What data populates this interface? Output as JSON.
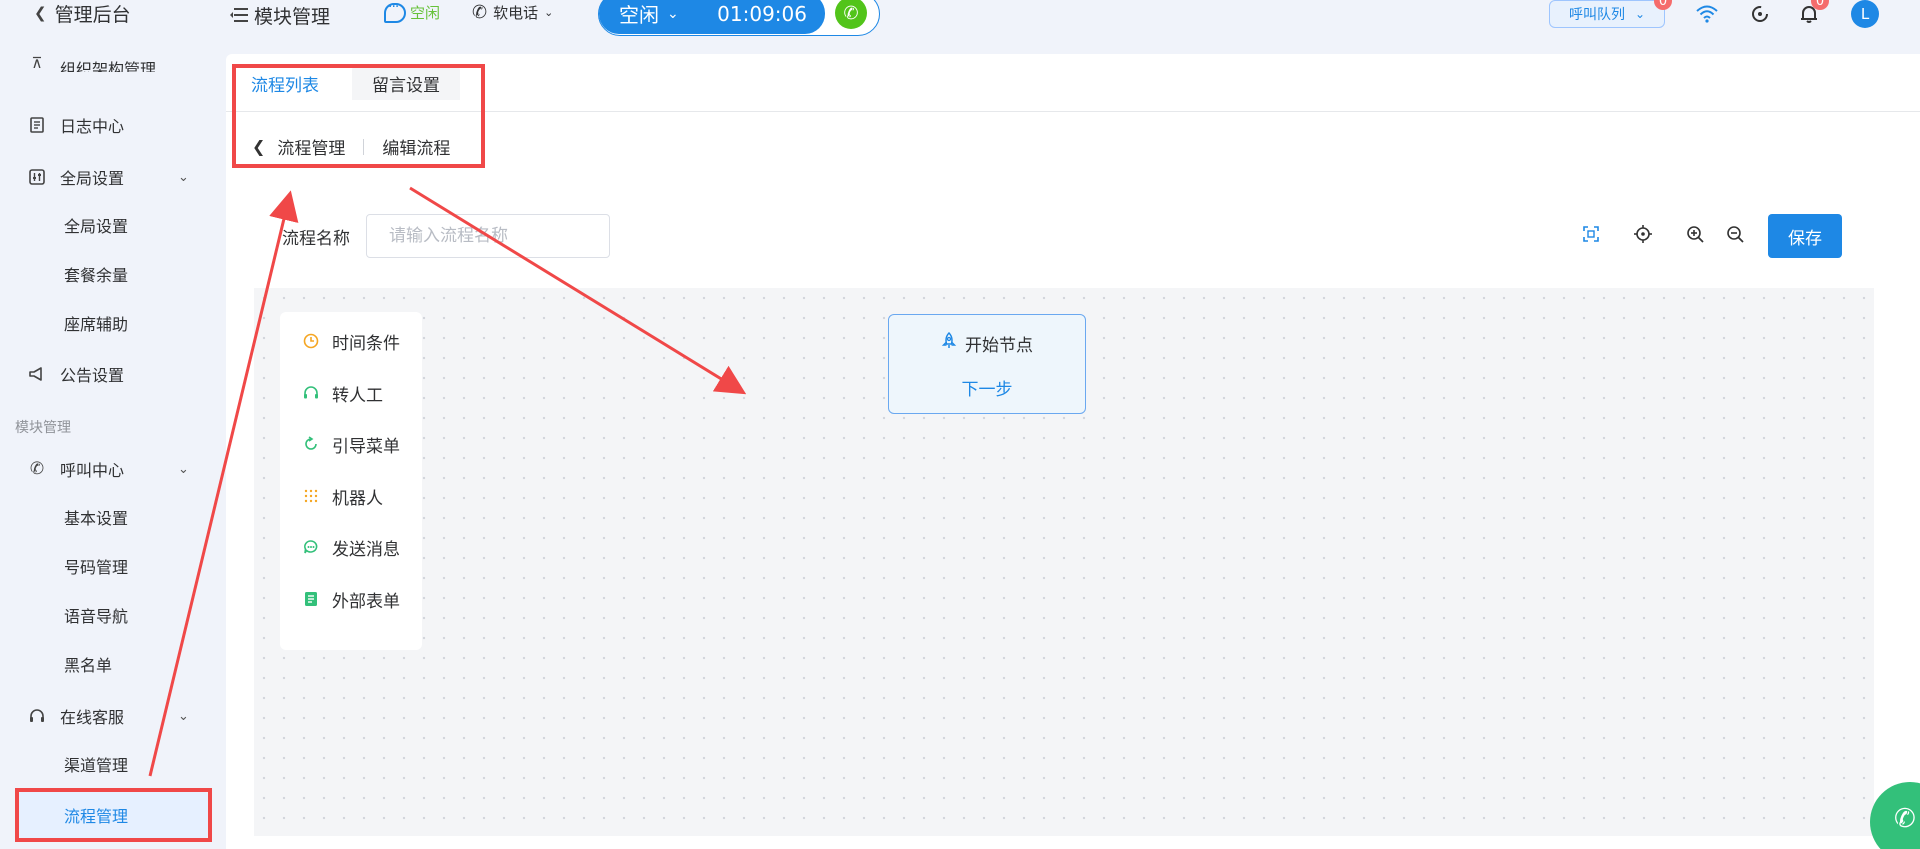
{
  "topbar": {
    "back_label": "管理后台",
    "module_label": "模块管理",
    "status_label": "空闲",
    "softphone_label": "软电话",
    "call_status": "空闲",
    "call_timer": "01:09:06",
    "queue_label": "呼叫队列",
    "queue_badge": "0",
    "notify_badge": "0",
    "avatar_letter": "L"
  },
  "sidebar": {
    "partial_item": "组织架构管理",
    "items": [
      {
        "label": "日志中心",
        "icon": "log-icon"
      },
      {
        "label": "全局设置",
        "icon": "settings-sliders-icon"
      }
    ],
    "global_sub": [
      "全局设置",
      "套餐余量",
      "座席辅助"
    ],
    "notice_label": "公告设置",
    "section_label": "模块管理",
    "call_center_label": "呼叫中心",
    "call_center_sub": [
      "基本设置",
      "号码管理",
      "语音导航",
      "黑名单"
    ],
    "online_service_label": "在线客服",
    "online_service_sub": [
      "渠道管理",
      "流程管理"
    ]
  },
  "tabs": [
    {
      "label": "流程列表",
      "active": true
    },
    {
      "label": "留言设置",
      "active": false
    }
  ],
  "breadcrumb": {
    "parent": "流程管理",
    "current": "编辑流程"
  },
  "form": {
    "name_label": "流程名称",
    "name_value": "",
    "name_placeholder": "请输入流程名称"
  },
  "toolbar": {
    "save_label": "保存"
  },
  "palette": [
    {
      "label": "时间条件",
      "icon": "clock-icon",
      "color": "#f5a623"
    },
    {
      "label": "转人工",
      "icon": "headset-icon",
      "color": "#33c07a"
    },
    {
      "label": "引导菜单",
      "icon": "refresh-icon",
      "color": "#33c07a"
    },
    {
      "label": "机器人",
      "icon": "robot-dots-icon",
      "color": "#f5a623"
    },
    {
      "label": "发送消息",
      "icon": "chat-icon",
      "color": "#33c07a"
    },
    {
      "label": "外部表单",
      "icon": "form-icon",
      "color": "#33c07a"
    }
  ],
  "start_node": {
    "title": "开始节点",
    "next_label": "下一步"
  },
  "colors": {
    "accent": "#1e88e5",
    "highlight": "#f04848"
  }
}
